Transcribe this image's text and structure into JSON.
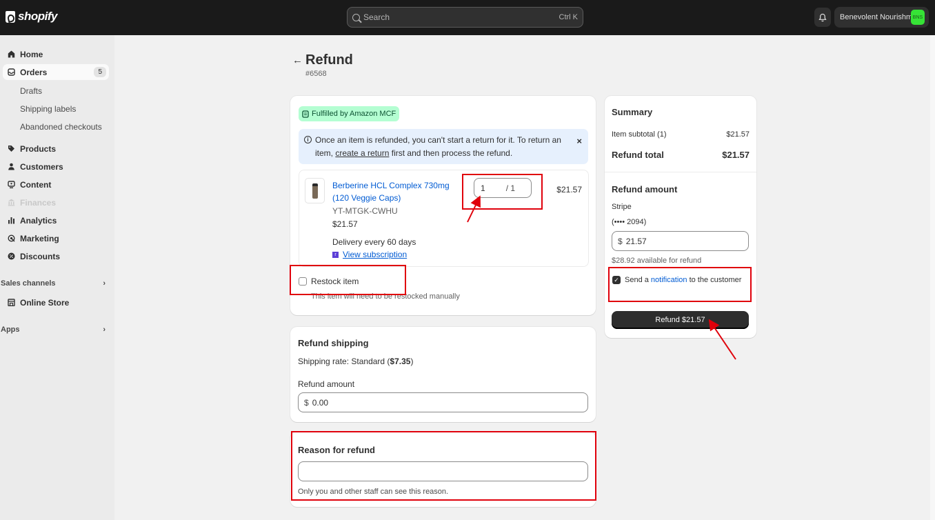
{
  "topbar": {
    "logo_text": "shopify",
    "search_placeholder": "Search",
    "search_shortcut": "Ctrl K",
    "store_name": "Benevolent Nourishm...",
    "store_initials": "BNS"
  },
  "sidebar": {
    "home": "Home",
    "orders": "Orders",
    "orders_count": "5",
    "drafts": "Drafts",
    "shipping_labels": "Shipping labels",
    "abandoned": "Abandoned checkouts",
    "products": "Products",
    "customers": "Customers",
    "content": "Content",
    "finances": "Finances",
    "analytics": "Analytics",
    "marketing": "Marketing",
    "discounts": "Discounts",
    "sales_channels": "Sales channels",
    "online_store": "Online Store",
    "apps": "Apps"
  },
  "page": {
    "title": "Refund",
    "order_number": "#6568"
  },
  "items_card": {
    "fulfilled_badge": "Fulfilled by Amazon MCF",
    "banner_text_1": "Once an item is refunded, you can't start a return for it. To return an item,",
    "banner_link": "create a return",
    "banner_text_2": "first and then process the refund.",
    "product_name": "Berberine HCL Complex 730mg (120 Veggie Caps)",
    "sku": "YT-MTGK-CWHU",
    "unit_price": "$21.57",
    "delivery": "Delivery every 60 days",
    "view_subscription": "View subscription",
    "qty_value": "1",
    "qty_of": "/ 1",
    "line_total": "$21.57",
    "restock_label": "Restock item",
    "restock_help": "This item will need to be restocked manually"
  },
  "shipping_card": {
    "title": "Refund shipping",
    "rate_prefix": "Shipping rate: Standard (",
    "rate_value": "$7.35",
    "rate_suffix": ")",
    "amount_label": "Refund amount",
    "currency": "$",
    "amount_value": "0.00"
  },
  "reason_card": {
    "title": "Reason for refund",
    "input_value": "",
    "help": "Only you and other staff can see this reason."
  },
  "summary": {
    "title": "Summary",
    "item_subtotal_label": "Item subtotal (1)",
    "item_subtotal_value": "$21.57",
    "refund_total_label": "Refund total",
    "refund_total_value": "$21.57",
    "refund_amount_title": "Refund amount",
    "gateway": "Stripe",
    "card": "(•••• 2094)",
    "currency": "$",
    "amount_value": "21.57",
    "available": "$28.92 available for refund",
    "notify_prefix": "Send a ",
    "notify_link": "notification",
    "notify_suffix": " to the customer",
    "refund_button": "Refund $21.57"
  },
  "colors": {
    "annotation": "#e0000b",
    "link": "#005bd3",
    "topbar": "#1a1a1a"
  }
}
